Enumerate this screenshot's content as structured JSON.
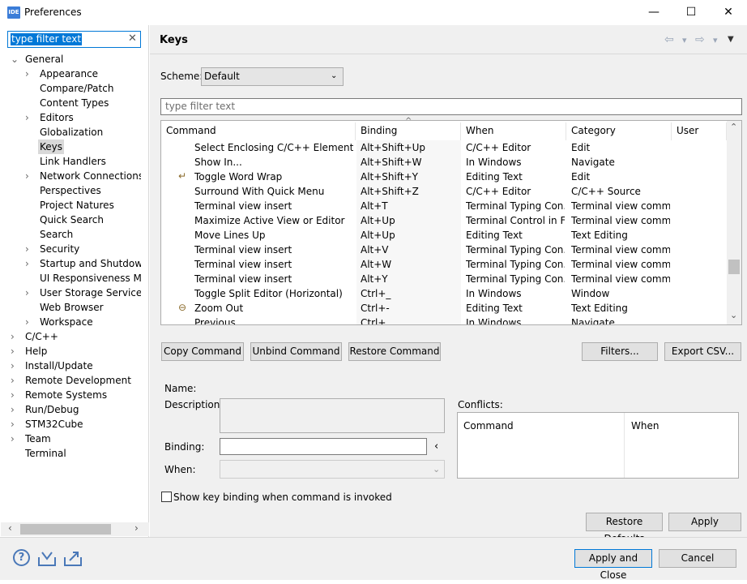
{
  "window": {
    "app_icon_text": "IDE",
    "title": "Preferences",
    "minimize_glyph": "—",
    "maximize_glyph": "☐",
    "close_glyph": "✕"
  },
  "tree": {
    "filter_text": "type filter text",
    "clear_glyph": "✕",
    "items": [
      {
        "label": "General",
        "depth": 0,
        "arrow": "⌄",
        "selected": false
      },
      {
        "label": "Appearance",
        "depth": 1,
        "arrow": "›",
        "selected": false
      },
      {
        "label": "Compare/Patch",
        "depth": 1,
        "arrow": "",
        "selected": false
      },
      {
        "label": "Content Types",
        "depth": 1,
        "arrow": "",
        "selected": false
      },
      {
        "label": "Editors",
        "depth": 1,
        "arrow": "›",
        "selected": false
      },
      {
        "label": "Globalization",
        "depth": 1,
        "arrow": "",
        "selected": false
      },
      {
        "label": "Keys",
        "depth": 1,
        "arrow": "",
        "selected": true
      },
      {
        "label": "Link Handlers",
        "depth": 1,
        "arrow": "",
        "selected": false
      },
      {
        "label": "Network Connections",
        "depth": 1,
        "arrow": "›",
        "selected": false
      },
      {
        "label": "Perspectives",
        "depth": 1,
        "arrow": "",
        "selected": false
      },
      {
        "label": "Project Natures",
        "depth": 1,
        "arrow": "",
        "selected": false
      },
      {
        "label": "Quick Search",
        "depth": 1,
        "arrow": "",
        "selected": false
      },
      {
        "label": "Search",
        "depth": 1,
        "arrow": "",
        "selected": false
      },
      {
        "label": "Security",
        "depth": 1,
        "arrow": "›",
        "selected": false
      },
      {
        "label": "Startup and Shutdown",
        "depth": 1,
        "arrow": "›",
        "selected": false
      },
      {
        "label": "UI Responsiveness Monit",
        "depth": 1,
        "arrow": "",
        "selected": false
      },
      {
        "label": "User Storage Service",
        "depth": 1,
        "arrow": "›",
        "selected": false
      },
      {
        "label": "Web Browser",
        "depth": 1,
        "arrow": "",
        "selected": false
      },
      {
        "label": "Workspace",
        "depth": 1,
        "arrow": "›",
        "selected": false
      },
      {
        "label": "C/C++",
        "depth": 0,
        "arrow": "›",
        "selected": false
      },
      {
        "label": "Help",
        "depth": 0,
        "arrow": "›",
        "selected": false
      },
      {
        "label": "Install/Update",
        "depth": 0,
        "arrow": "›",
        "selected": false
      },
      {
        "label": "Remote Development",
        "depth": 0,
        "arrow": "›",
        "selected": false
      },
      {
        "label": "Remote Systems",
        "depth": 0,
        "arrow": "›",
        "selected": false
      },
      {
        "label": "Run/Debug",
        "depth": 0,
        "arrow": "›",
        "selected": false
      },
      {
        "label": "STM32Cube",
        "depth": 0,
        "arrow": "›",
        "selected": false
      },
      {
        "label": "Team",
        "depth": 0,
        "arrow": "›",
        "selected": false
      },
      {
        "label": "Terminal",
        "depth": 0,
        "arrow": "",
        "selected": false
      }
    ],
    "hscroll_left": "‹",
    "hscroll_right": "›"
  },
  "page": {
    "title": "Keys",
    "nav_back": "⇦",
    "nav_forward": "⇨",
    "nav_dropdown": "▾",
    "menu": "▼"
  },
  "scheme": {
    "label": "Scheme:",
    "value": "Default",
    "arrow": "⌄"
  },
  "keys_filter_placeholder": "type filter text",
  "table": {
    "sort_glyph": "^",
    "columns": [
      "Command",
      "Binding",
      "When",
      "Category",
      "User"
    ],
    "rows": [
      {
        "icon": "",
        "command": "Select Enclosing C/C++ Element",
        "binding": "Alt+Shift+Up",
        "when": "C/C++ Editor",
        "category": "Edit"
      },
      {
        "icon": "",
        "command": "Show In...",
        "binding": "Alt+Shift+W",
        "when": "In Windows",
        "category": "Navigate"
      },
      {
        "icon": "word-wrap-icon",
        "command": "Toggle Word Wrap",
        "binding": "Alt+Shift+Y",
        "when": "Editing Text",
        "category": "Edit"
      },
      {
        "icon": "",
        "command": "Surround With Quick Menu",
        "binding": "Alt+Shift+Z",
        "when": "C/C++ Editor",
        "category": "C/C++ Source"
      },
      {
        "icon": "",
        "command": "Terminal view insert",
        "binding": "Alt+T",
        "when": "Terminal Typing Con...",
        "category": "Terminal view comm..."
      },
      {
        "icon": "",
        "command": "Maximize Active View or Editor",
        "binding": "Alt+Up",
        "when": "Terminal Control in F...",
        "category": "Terminal view comm..."
      },
      {
        "icon": "",
        "command": "Move Lines Up",
        "binding": "Alt+Up",
        "when": "Editing Text",
        "category": "Text Editing"
      },
      {
        "icon": "",
        "command": "Terminal view insert",
        "binding": "Alt+V",
        "when": "Terminal Typing Con...",
        "category": "Terminal view comm..."
      },
      {
        "icon": "",
        "command": "Terminal view insert",
        "binding": "Alt+W",
        "when": "Terminal Typing Con...",
        "category": "Terminal view comm..."
      },
      {
        "icon": "",
        "command": "Terminal view insert",
        "binding": "Alt+Y",
        "when": "Terminal Typing Con...",
        "category": "Terminal view comm..."
      },
      {
        "icon": "",
        "command": "Toggle Split Editor (Horizontal)",
        "binding": "Ctrl+_",
        "when": "In Windows",
        "category": "Window"
      },
      {
        "icon": "zoom-out-icon",
        "command": "Zoom Out",
        "binding": "Ctrl+-",
        "when": "Editing Text",
        "category": "Text Editing"
      },
      {
        "icon": "",
        "command": "Previous",
        "binding": "Ctrl+,",
        "when": "In Windows",
        "category": "Navigate"
      }
    ],
    "scroll_up": "⌃",
    "scroll_down": "⌄"
  },
  "buttons": {
    "copy_command": "Copy Command",
    "unbind_command": "Unbind Command",
    "restore_command": "Restore Command",
    "filters": "Filters...",
    "export_csv": "Export CSV...",
    "restore_defaults": "Restore Defaults",
    "apply": "Apply",
    "apply_and_close": "Apply and Close",
    "cancel": "Cancel"
  },
  "details": {
    "name_label": "Name:",
    "description_label": "Description:",
    "binding_label": "Binding:",
    "binding_arrow": "‹",
    "when_label": "When:",
    "when_arrow": "⌄",
    "conflicts_label": "Conflicts:",
    "conflicts_columns": [
      "Command",
      "When"
    ],
    "show_key_binding_label": "Show key binding when command is invoked"
  },
  "bottom_icons": [
    "help-icon",
    "import-icon",
    "export-icon"
  ]
}
